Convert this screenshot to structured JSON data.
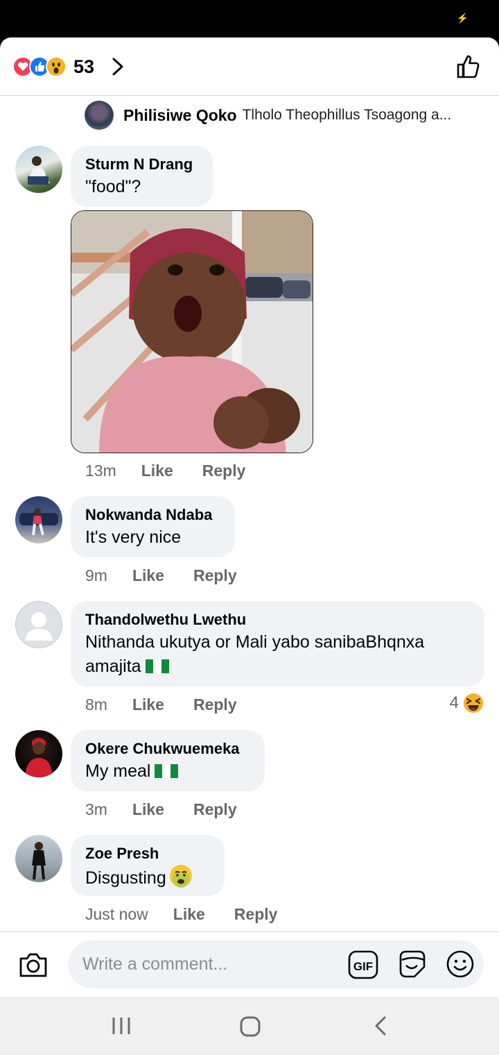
{
  "header": {
    "reaction_count": "53",
    "reaction_icons": [
      "love-icon",
      "like-icon",
      "wow-icon"
    ]
  },
  "typing": {
    "name": "Philisiwe Qoko",
    "text": "Tlholo Theophillus Tsoagong a..."
  },
  "comments": [
    {
      "author": "Sturm N Drang",
      "text": "\"food\"?",
      "time": "13m",
      "like": "Like",
      "reply": "Reply",
      "has_photo": true
    },
    {
      "author": "Nokwanda Ndaba",
      "text": "It's very nice",
      "time": "9m",
      "like": "Like",
      "reply": "Reply"
    },
    {
      "author": "Thandolwethu Lwethu",
      "text": "Nithanda ukutya or Mali yabo sanibaBhqnxa",
      "text2": "amajita",
      "time": "8m",
      "like": "Like",
      "reply": "Reply",
      "reaction_count": "4",
      "reaction_icon": "laughing-emoji-icon"
    },
    {
      "author": "Okere Chukwuemeka",
      "text": "My meal",
      "time": "3m",
      "like": "Like",
      "reply": "Reply"
    },
    {
      "author": "Zoe Presh",
      "text": "Disgusting",
      "time": "Just now",
      "like": "Like",
      "reply": "Reply"
    }
  ],
  "composer": {
    "placeholder": "Write a comment..."
  },
  "colors": {
    "love": "#f33e58",
    "like": "#1877f2",
    "wow": "#f7b125",
    "bubble": "#f0f2f5",
    "meta_text": "#65676b"
  }
}
